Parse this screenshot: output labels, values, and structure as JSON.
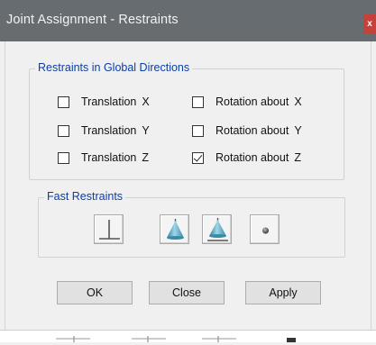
{
  "window": {
    "title": "Joint Assignment - Restraints",
    "close_glyph": "x"
  },
  "global_restraints": {
    "legend": "Restraints in Global Directions",
    "items": [
      {
        "word": "Translation",
        "axis": "X",
        "checked": false
      },
      {
        "word": "Rotation about",
        "axis": "X",
        "checked": false
      },
      {
        "word": "Translation",
        "axis": "Y",
        "checked": false
      },
      {
        "word": "Rotation about",
        "axis": "Y",
        "checked": false
      },
      {
        "word": "Translation",
        "axis": "Z",
        "checked": false
      },
      {
        "word": "Rotation about",
        "axis": "Z",
        "checked": true
      }
    ]
  },
  "fast_restraints": {
    "legend": "Fast Restraints",
    "buttons": [
      "fixed-support-icon",
      "pinned-support-icon",
      "roller-support-icon",
      "free-joint-icon"
    ]
  },
  "buttons": {
    "ok": "OK",
    "close": "Close",
    "apply": "Apply"
  },
  "colors": {
    "titlebar": "#676c70",
    "legend_text": "#0a3ea8",
    "close_button": "#c8403a",
    "icon_cone": "#4a9dba"
  }
}
